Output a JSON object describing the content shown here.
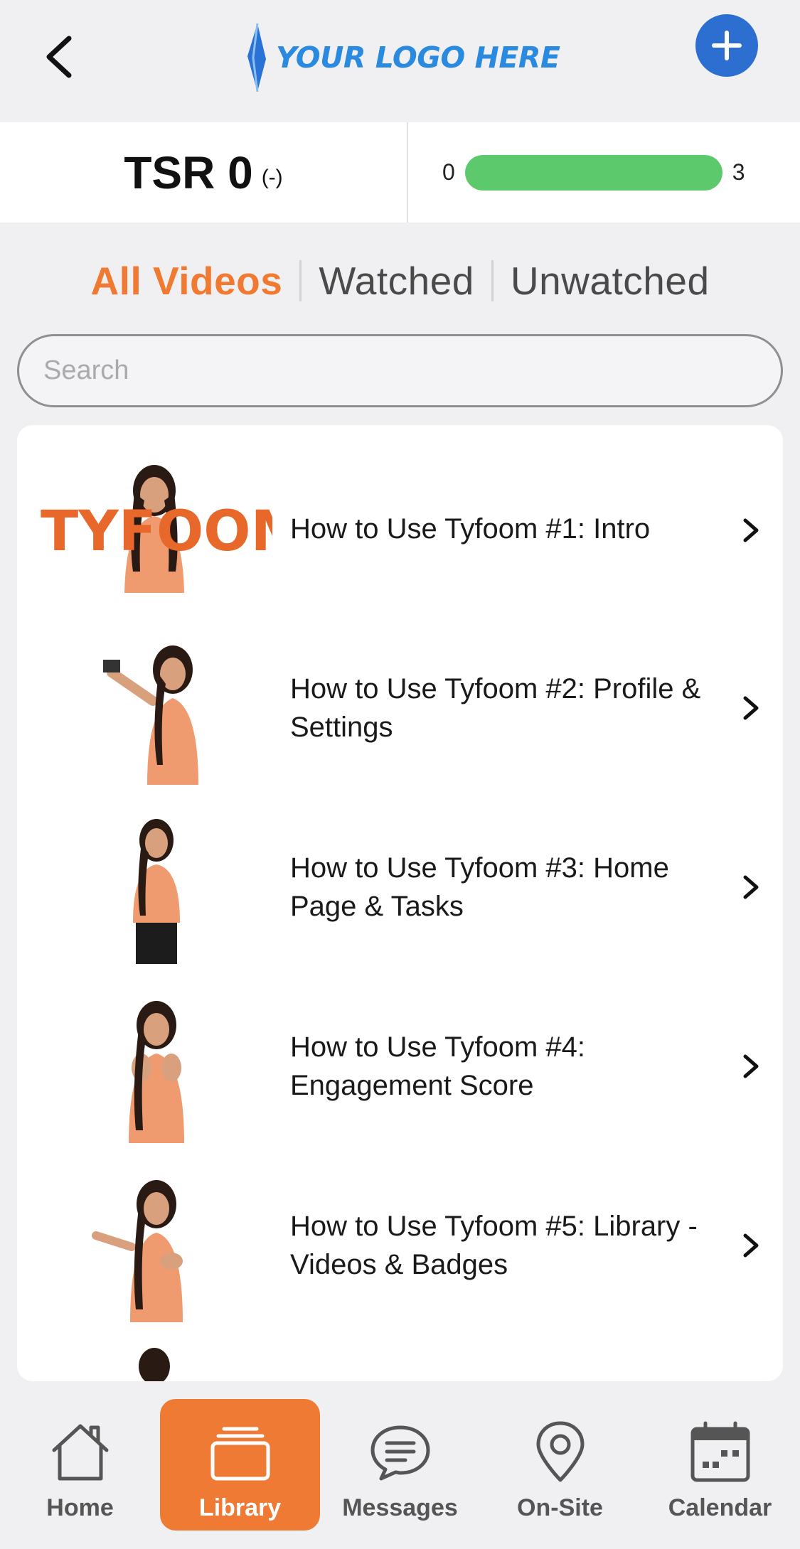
{
  "header": {
    "logo_text": "YOUR LOGO HERE",
    "back_icon": "chevron-left-icon",
    "add_icon": "plus-icon",
    "accent_color": "#2c6fd0"
  },
  "stats": {
    "tsr_label": "TSR 0",
    "tsr_delta": "(-)",
    "progress_min": "0",
    "progress_max": "3",
    "progress_fill_fraction": 1.0,
    "progress_color": "#5cc96c"
  },
  "tabs": [
    {
      "label": "All Videos",
      "active": true
    },
    {
      "label": "Watched",
      "active": false
    },
    {
      "label": "Unwatched",
      "active": false
    }
  ],
  "search": {
    "placeholder": "Search",
    "value": ""
  },
  "videos": [
    {
      "title": "How to Use Tyfoom #1: Intro",
      "thumb_text": "TYFOOM"
    },
    {
      "title": "How to Use Tyfoom #2: Profile & Settings"
    },
    {
      "title": "How to Use Tyfoom #3: Home Page & Tasks"
    },
    {
      "title": "How to Use Tyfoom #4: Engagement Score"
    },
    {
      "title": "How to Use Tyfoom #5: Library - Videos & Badges"
    }
  ],
  "nav": [
    {
      "label": "Home",
      "icon": "home-icon",
      "active": false
    },
    {
      "label": "Library",
      "icon": "library-icon",
      "active": true
    },
    {
      "label": "Messages",
      "icon": "chat-bubble-icon",
      "active": false
    },
    {
      "label": "On-Site",
      "icon": "map-pin-icon",
      "active": false
    },
    {
      "label": "Calendar",
      "icon": "calendar-icon",
      "active": false
    }
  ],
  "colors": {
    "active_tab": "#f07a32",
    "active_nav_bg": "#ef7a33"
  }
}
